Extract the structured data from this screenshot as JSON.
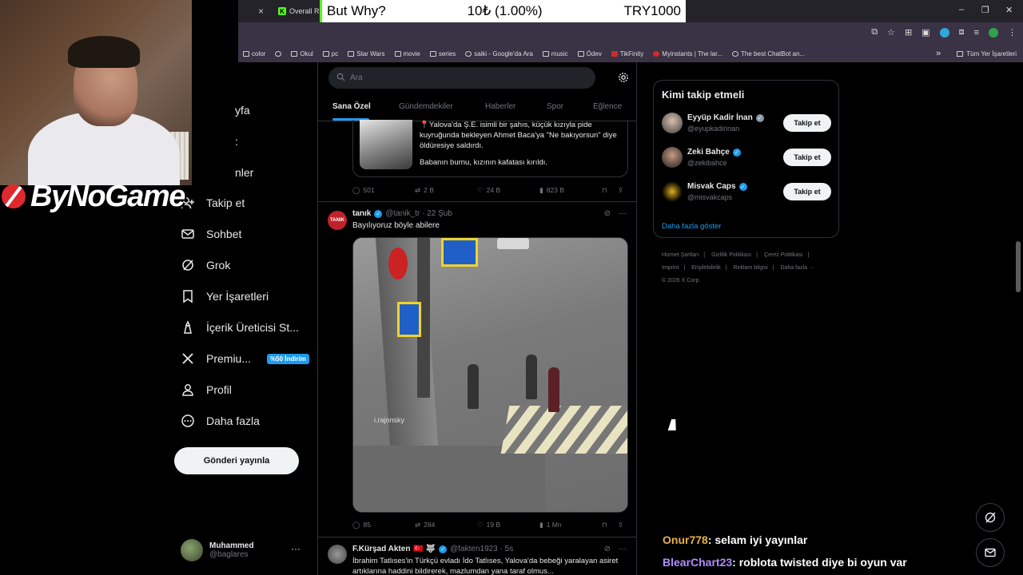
{
  "overlay": {
    "banner": {
      "left": "But Why?",
      "middle": "10₺ (1.00%)",
      "right": "TRY1000"
    },
    "brand": "ByNoGame"
  },
  "browser": {
    "tab_close": "×",
    "tab_title": "Overall R",
    "tab_favicon": "K",
    "win_min": "–",
    "win_max": "❐",
    "win_close": "✕",
    "bookmarks": [
      {
        "label": "color",
        "icon": "folder-icon"
      },
      {
        "label": "",
        "icon": "globe-icon"
      },
      {
        "label": "Okul",
        "icon": "folder-icon"
      },
      {
        "label": "pc",
        "icon": "folder-icon"
      },
      {
        "label": "Star Wars",
        "icon": "folder-icon"
      },
      {
        "label": "movie",
        "icon": "folder-icon"
      },
      {
        "label": "series",
        "icon": "folder-icon"
      },
      {
        "label": "saiki - Google'da Ara",
        "icon": "google-icon"
      },
      {
        "label": "music",
        "icon": "folder-icon"
      },
      {
        "label": "Ödev",
        "icon": "folder-icon"
      },
      {
        "label": "TikFinity",
        "icon": "tikfinity-icon"
      },
      {
        "label": "Myinstants | The lar...",
        "icon": "myinstants-icon"
      },
      {
        "label": "The best ChatBot an...",
        "icon": "chatbot-icon"
      }
    ],
    "bookmarks_overflow": "»",
    "all_bookmarks": "Tüm Yer İşaretleri"
  },
  "nav": {
    "partial": [
      "yfa",
      ":",
      "nler"
    ],
    "items": [
      {
        "label": "Takip et",
        "icon": "person-add-icon",
        "glyph": "＋"
      },
      {
        "label": "Sohbet",
        "icon": "envelope-icon",
        "glyph": "✉"
      },
      {
        "label": "Grok",
        "icon": "grok-icon",
        "glyph": "⊘"
      },
      {
        "label": "Yer İşaretleri",
        "icon": "bookmark-icon",
        "glyph": "🔖"
      },
      {
        "label": "İçerik Üreticisi St...",
        "icon": "creator-studio-icon",
        "glyph": "♙"
      },
      {
        "label": "Premiu...",
        "icon": "x-logo-icon",
        "glyph": "𝕏",
        "badge": "%50 İndirim"
      },
      {
        "label": "Profil",
        "icon": "profile-icon",
        "glyph": "👤"
      },
      {
        "label": "Daha fazla",
        "icon": "more-circle-icon",
        "glyph": "⋯"
      }
    ],
    "post_button": "Gönderi yayınla",
    "account": {
      "name": "Muhammed",
      "handle": "@baglares",
      "more": "···"
    }
  },
  "timeline": {
    "search_placeholder": "Ara",
    "tabs": [
      "Sana Özel",
      "Gündemdekiler",
      "Haberler",
      "Spor",
      "Eğlence"
    ],
    "tweet1": {
      "card_text": "📍Yalova'da Ş.E. isimli bir şahıs, küçük kızıyla pide kuyruğunda bekleyen Ahmet Baca'ya \"Ne bakıyorsun\" diye öldüresiye saldırdı.",
      "card_text2": "Babanın burnu, kızının kafatası kırıldı.",
      "replies": "501",
      "reposts": "2 B",
      "likes": "24 B",
      "views": "823 B"
    },
    "tweet2": {
      "avatar_text": "TANIK",
      "name": "tanık",
      "handle": "@tanik_tr · 22 Şub",
      "text": "Bayılıyoruz böyle abilere",
      "watermark": "i.rajonsky",
      "replies": "85",
      "reposts": "284",
      "likes": "19 B",
      "views": "1 Mn"
    },
    "tweet3": {
      "name": "F.Kürşad Akten",
      "flags": "🇹🇷 🐺",
      "handle": "@fakten1923 · 5s",
      "text": "İbrahim Tatlıses'in Türkçü evladı İdo Tatlıses, Yalova'da bebeği yaralayan asiret artıklarına haddini bildirerek, mazlumdan yana taraf olmus..."
    }
  },
  "who_to_follow": {
    "title": "Kimi takip etmeli",
    "users": [
      {
        "name": "Eyyüp Kadir İnan",
        "handle": "@eyupkadirinan",
        "button": "Takip et",
        "verified_color": "#8b98a5"
      },
      {
        "name": "Zeki Bahçe",
        "handle": "@zekibahce",
        "button": "Takip et",
        "verified_color": "#1d9bf0"
      },
      {
        "name": "Misvak Caps",
        "handle": "@misvakcaps",
        "button": "Takip et",
        "verified_color": "#1d9bf0"
      }
    ],
    "more": "Daha fazla göster"
  },
  "footer": {
    "links": [
      "Hizmet Şartları",
      "|",
      "Gizlilik Politikası",
      "|",
      "Çerez Politikası",
      "|",
      "Imprint",
      "|",
      "Erişilebilirlik",
      "|",
      "Reklam bilgisi",
      "|",
      "Daha fazla ···"
    ],
    "copyright": "© 2026 X Corp."
  },
  "chat": [
    {
      "user": "Onur778",
      "message": ": selam iyi yayınlar"
    },
    {
      "user": "BlearChart23",
      "message": ": roblota twisted diye bi oyun var"
    }
  ],
  "colors": {
    "accent": "#1d9bf0",
    "background": "#000000",
    "kick_green": "#53fc18"
  }
}
